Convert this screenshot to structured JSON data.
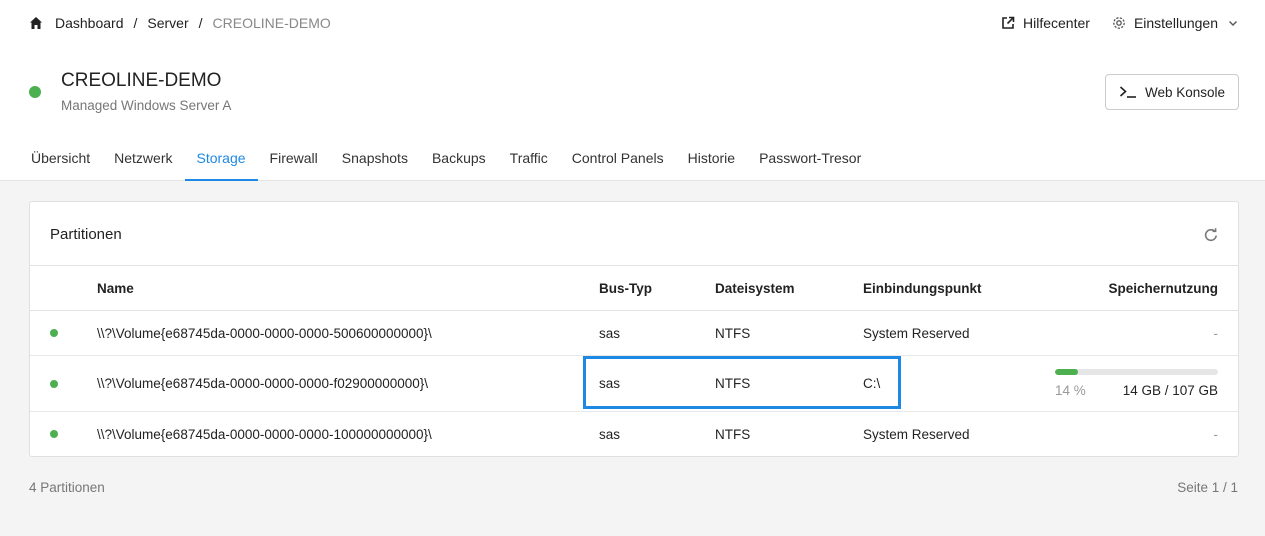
{
  "breadcrumb": {
    "home_icon": "home-icon",
    "items": [
      "Dashboard",
      "Server"
    ],
    "separator": "/",
    "current": "CREOLINE-DEMO"
  },
  "topbar": {
    "help_label": "Hilfecenter",
    "help_icon": "external-link-icon",
    "settings_label": "Einstellungen",
    "settings_icon": "gear-icon"
  },
  "server": {
    "name": "CREOLINE-DEMO",
    "subtitle": "Managed Windows Server A",
    "status_color": "#4caf50"
  },
  "web_console": {
    "label": "Web Konsole",
    "icon": "terminal-icon"
  },
  "tabs": [
    {
      "label": "Übersicht"
    },
    {
      "label": "Netzwerk"
    },
    {
      "label": "Storage",
      "active": true
    },
    {
      "label": "Firewall"
    },
    {
      "label": "Snapshots"
    },
    {
      "label": "Backups"
    },
    {
      "label": "Traffic"
    },
    {
      "label": "Control Panels"
    },
    {
      "label": "Historie"
    },
    {
      "label": "Passwort-Tresor"
    }
  ],
  "partitions": {
    "title": "Partitionen",
    "refresh_icon": "refresh-icon",
    "columns": {
      "name": "Name",
      "bus": "Bus-Typ",
      "fs": "Dateisystem",
      "mount": "Einbindungspunkt",
      "usage": "Speichernutzung"
    },
    "rows": [
      {
        "name": "\\\\?\\Volume{e68745da-0000-0000-0000-500600000000}\\",
        "bus": "sas",
        "fs": "NTFS",
        "mount": "System Reserved",
        "usage": "-"
      },
      {
        "name": "\\\\?\\Volume{e68745da-0000-0000-0000-f02900000000}\\",
        "bus": "sas",
        "fs": "NTFS",
        "mount": "C:\\",
        "usage_pct": "14 %",
        "usage_size": "14 GB / 107 GB",
        "usage_fraction": 0.14
      },
      {
        "name": "\\\\?\\Volume{e68745da-0000-0000-0000-100000000000}\\",
        "bus": "sas",
        "fs": "NTFS",
        "mount": "System Reserved",
        "usage": "-"
      }
    ]
  },
  "footer": {
    "count": "4 Partitionen",
    "page": "Seite 1 / 1"
  },
  "colors": {
    "accent": "#1e88e5",
    "success": "#4caf50"
  }
}
